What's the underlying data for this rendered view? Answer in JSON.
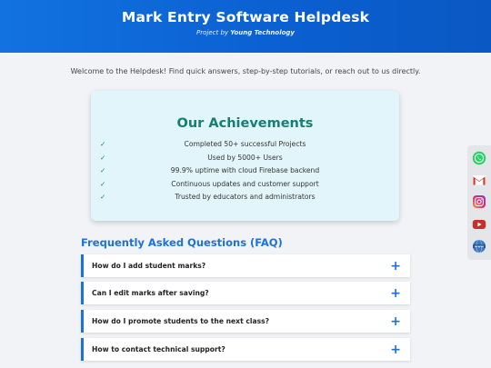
{
  "header": {
    "title": "Mark Entry Software Helpdesk",
    "subtitle_prefix": "Project by",
    "subtitle_company": "Young Technology"
  },
  "welcome": "Welcome to the Helpdesk! Find quick answers, step-by-step tutorials, or reach out to us directly.",
  "achievements": {
    "title": "Our Achievements",
    "check": "✓",
    "items": [
      "Completed 50+ successful Projects",
      "Used by 5000+ Users",
      "99.9% uptime with cloud Firebase backend",
      "Continuous updates and customer support",
      "Trusted by educators and administrators"
    ]
  },
  "faq": {
    "title": "Frequently Asked Questions (FAQ)",
    "expand_icon": "+",
    "items": [
      "How do I add student marks?",
      "Can I edit marks after saving?",
      "How do I promote students to the next class?",
      "How to contact technical support?"
    ]
  },
  "social": {
    "icons": [
      "whatsapp-icon",
      "gmail-icon",
      "instagram-icon",
      "youtube-icon",
      "website-icon"
    ],
    "website_text": "www"
  },
  "colors": {
    "header": "#0b5fd0",
    "accent": "#1a73d9",
    "achievement_green": "#15806f",
    "card_bg": "#e2f5fb"
  }
}
